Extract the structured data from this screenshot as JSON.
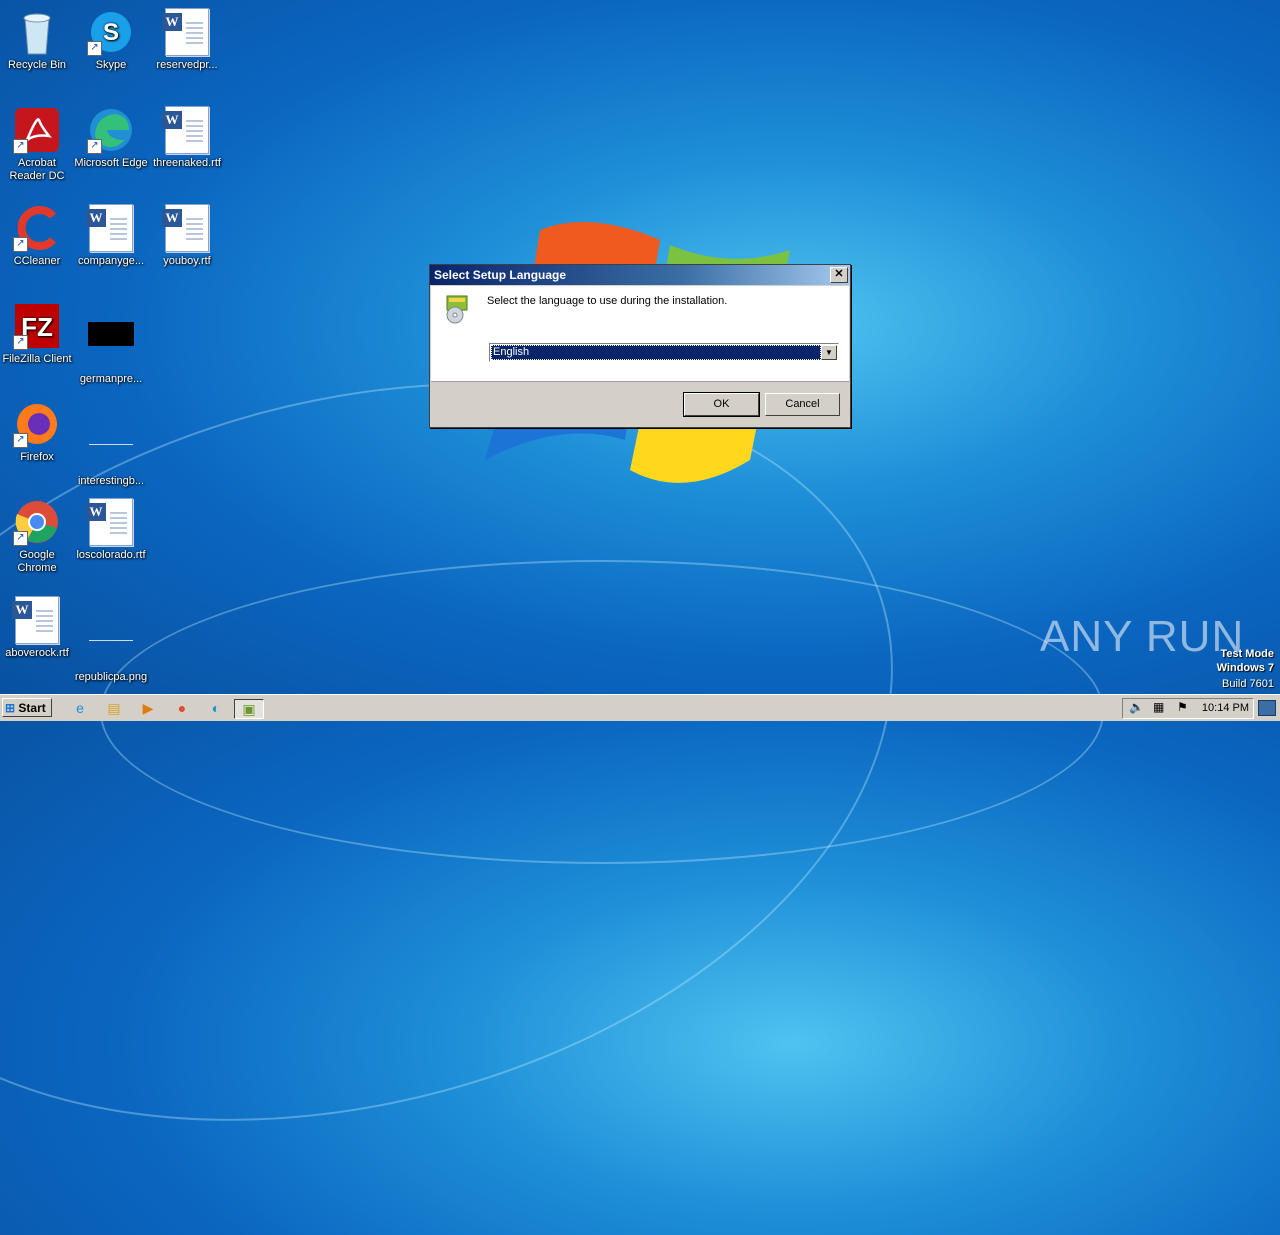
{
  "desktop": {
    "icons": [
      {
        "label": "Recycle Bin"
      },
      {
        "label": "Skype"
      },
      {
        "label": "reservedpr..."
      },
      {
        "label": "Acrobat Reader DC"
      },
      {
        "label": "Microsoft Edge"
      },
      {
        "label": "threenaked.rtf"
      },
      {
        "label": "CCleaner"
      },
      {
        "label": "companyge..."
      },
      {
        "label": "youboy.rtf"
      },
      {
        "label": "FileZilla Client"
      },
      {
        "label": "germanpre..."
      },
      {
        "label": "Firefox"
      },
      {
        "label": "interestingb..."
      },
      {
        "label": "Google Chrome"
      },
      {
        "label": "loscolorado.rtf"
      },
      {
        "label": "aboverock.rtf"
      },
      {
        "label": "republicpa.png"
      }
    ]
  },
  "dialog": {
    "title": "Select Setup Language",
    "close": "✕",
    "prompt": "Select the language to use during the installation.",
    "language_selected": "English",
    "ok_label": "OK",
    "cancel_label": "Cancel"
  },
  "taskbar": {
    "start_label": "Start",
    "clock": "10:14 PM"
  },
  "watermark": {
    "brand": "ANY RUN",
    "mode": "Test Mode",
    "os": "Windows 7",
    "build": "Build 7601"
  },
  "colors": {
    "title_bar": "#0a246a",
    "selection": "#0a246a",
    "desktop": "#0b66c0"
  }
}
